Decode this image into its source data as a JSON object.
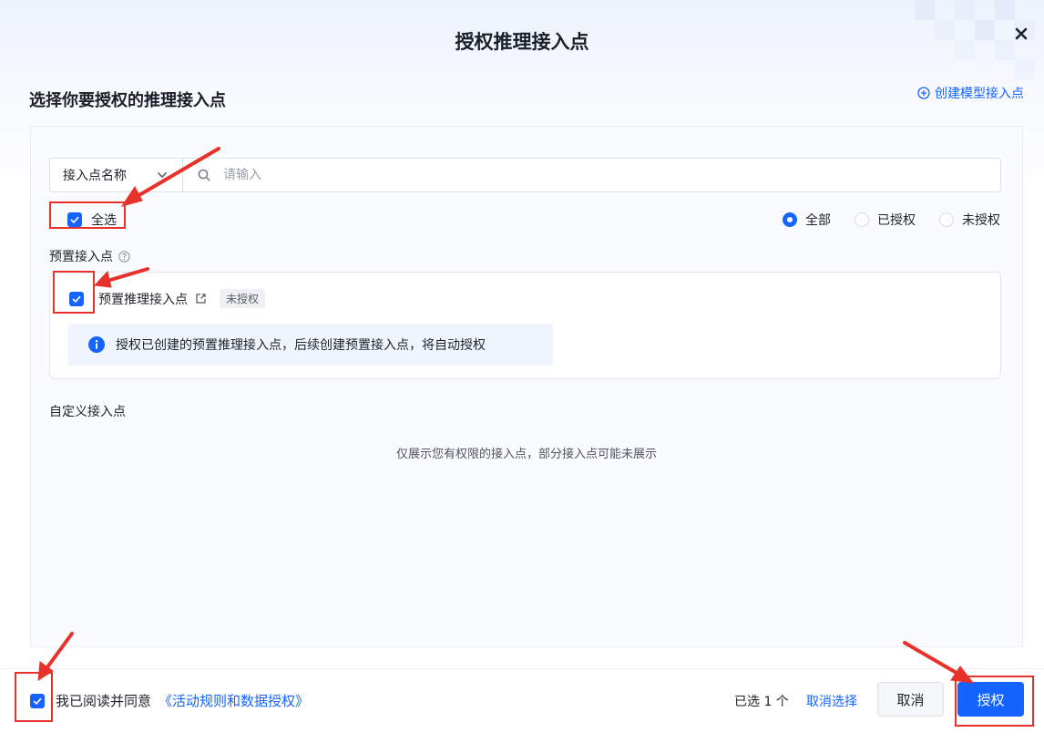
{
  "modal": {
    "title": "授权推理接入点",
    "close_icon": "close-icon"
  },
  "section": {
    "title": "选择你要授权的推理接入点",
    "create_link": "创建模型接入点"
  },
  "search": {
    "field_label": "接入点名称",
    "placeholder": "请输入"
  },
  "select_all": {
    "label": "全选",
    "checked": true
  },
  "filter": {
    "options": [
      "全部",
      "已授权",
      "未授权"
    ],
    "selected": "全部"
  },
  "preset": {
    "group_label": "预置接入点",
    "item_name": "预置推理接入点",
    "item_status": "未授权",
    "item_checked": true,
    "info_text": "授权已创建的预置推理接入点，后续创建预置接入点，将自动授权"
  },
  "custom": {
    "group_label": "自定义接入点",
    "empty_note": "仅展示您有权限的接入点，部分接入点可能未展示"
  },
  "footer": {
    "agree_text": "我已阅读并同意",
    "agree_link": "《活动规则和数据授权》",
    "agree_checked": true,
    "selected_count": "已选 1 个",
    "cancel_selection": "取消选择",
    "cancel_button": "取消",
    "confirm_button": "授权"
  },
  "colors": {
    "primary": "#1664ff",
    "annotation": "#e8312a"
  }
}
